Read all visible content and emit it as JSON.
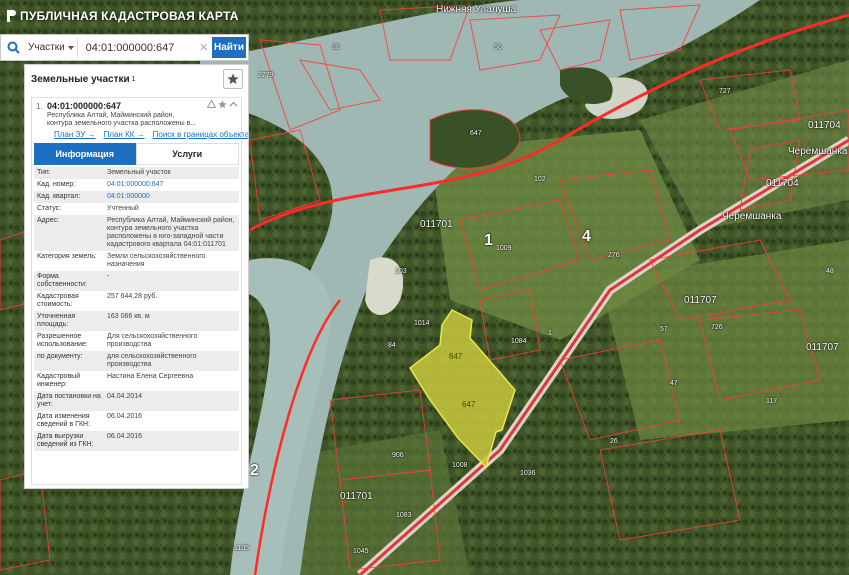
{
  "app": {
    "title": "ПУБЛИЧНАЯ КАДАСТРОВАЯ КАРТА"
  },
  "search": {
    "type_label": "Участки",
    "query": "04:01:000000:647",
    "button_label": "Найти"
  },
  "panel": {
    "title": "Земельные участки",
    "count": "1",
    "result": {
      "index": "1.",
      "cad_number": "04:01:000000:647",
      "address_short": "Республика Алтай, Майминский район, контура земельного участка расположены в...",
      "links": [
        "План ЗУ →",
        "План КК →",
        "Поиск в границах объекта →"
      ],
      "tabs": [
        "Информация",
        "Услуги"
      ],
      "attributes": [
        {
          "key": "Тип:",
          "value": "Земельный участок",
          "link": false
        },
        {
          "key": "Кад. номер:",
          "value": "04:01:000000:647",
          "link": true
        },
        {
          "key": "Кад. квартал:",
          "value": "04:01:000000",
          "link": true
        },
        {
          "key": "Статус:",
          "value": "Учтенный",
          "link": false
        },
        {
          "key": "Адрес:",
          "value": "Республика Алтай, Майминский район, контура земельного участка расположены в юго-западной части кадастрового квартала 04:01:011701",
          "link": false
        },
        {
          "key": "Категория земель:",
          "value": "Земли сельскохозяйственного назначения",
          "link": false
        },
        {
          "key": "Форма собственности:",
          "value": "-",
          "link": false
        },
        {
          "key": "Кадастровая стоимость:",
          "value": "257 644,28 руб.",
          "link": false
        },
        {
          "key": "Уточненная площадь:",
          "value": "163 066 кв. м",
          "link": false
        },
        {
          "key": "Разрешенное использование:",
          "value": "Для сельскохозяйственного производства",
          "link": false
        },
        {
          "key": "по документу:",
          "value": "для сельскохозяйственного производства",
          "link": false
        },
        {
          "key": "Кадастровый инженер:",
          "value": "Настина Елена Сергеевна",
          "link": false
        },
        {
          "key": "Дата постановки на учет:",
          "value": "04.04.2014",
          "link": false
        },
        {
          "key": "Дата изменения сведений в ГКН:",
          "value": "06.04.2016",
          "link": false
        },
        {
          "key": "Дата выгрузки сведений из ГКН:",
          "value": "06.04.2016",
          "link": false
        }
      ]
    }
  },
  "map": {
    "labels": [
      "Нижняя Улалуша",
      "011701",
      "011704",
      "011707",
      "011707",
      "011701",
      "011704",
      "Черемшанка",
      "Черемшанка",
      "1",
      "4",
      "2",
      "647",
      "647",
      "647",
      "1008",
      "1009",
      "1084",
      "1014",
      "56",
      "57",
      "103",
      "84",
      "2779",
      "1045",
      "1105",
      "38",
      "102",
      "906",
      "1036",
      "1083",
      "276",
      "727",
      "726",
      "117",
      "1",
      "26",
      "47",
      "48"
    ]
  },
  "colors": {
    "accent": "#1d6fc2",
    "river": "#9fb8b4",
    "parcel_fill": "#c8c83c",
    "boundary": "#e02020"
  }
}
